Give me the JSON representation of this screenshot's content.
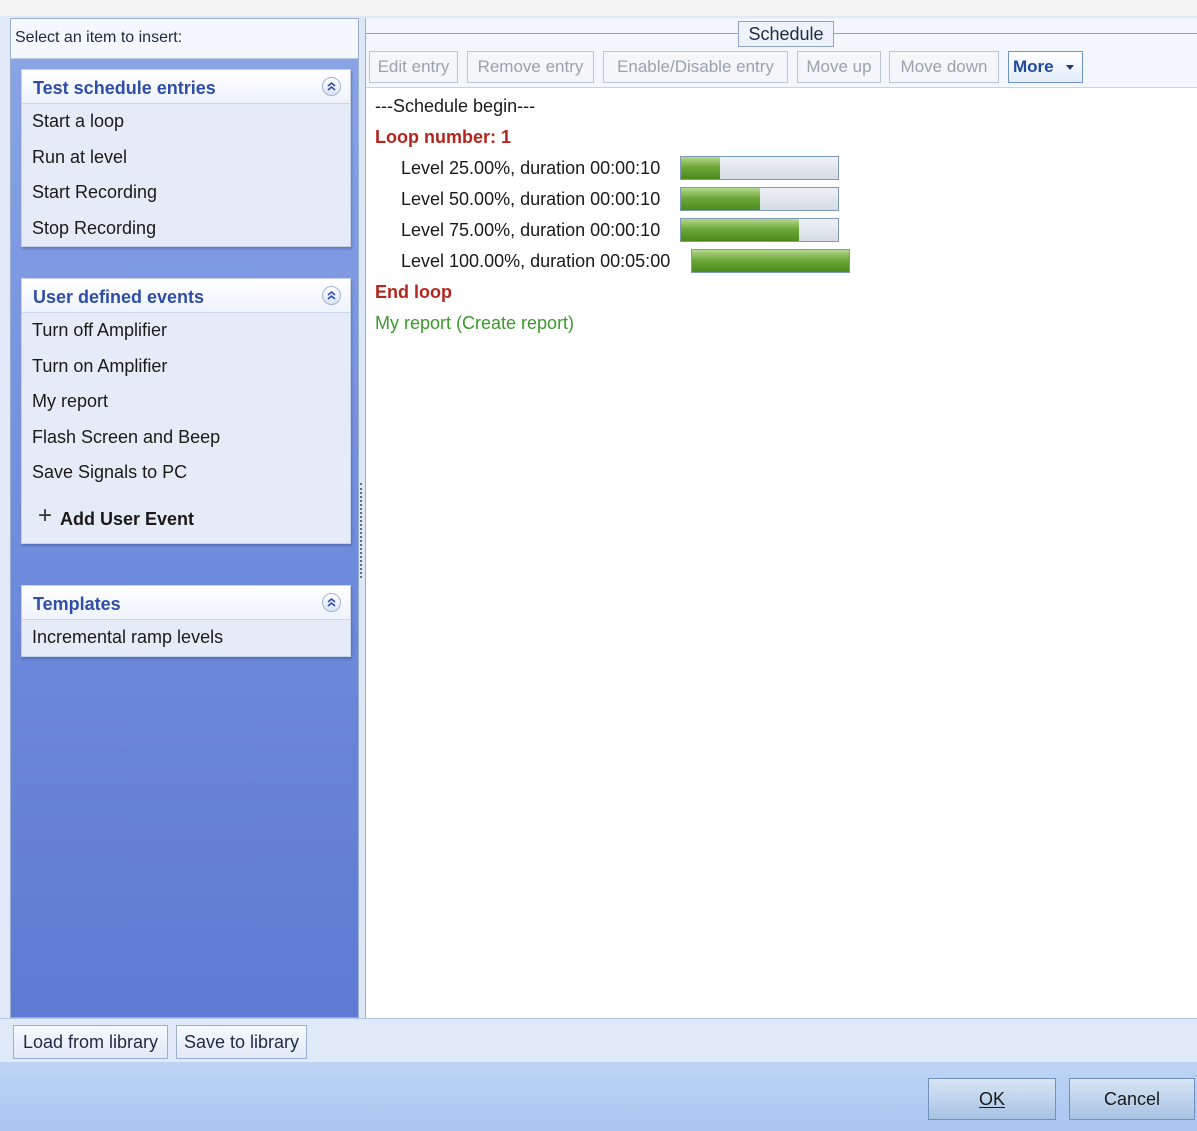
{
  "left": {
    "header": "Select an item to insert:",
    "groups": [
      {
        "title": "Test schedule entries",
        "items": [
          "Start a loop",
          "Run at level",
          "Start Recording",
          "Stop Recording"
        ]
      },
      {
        "title": "User defined events",
        "items": [
          "Turn off Amplifier",
          "Turn on Amplifier",
          "My report",
          "Flash Screen and Beep",
          "Save Signals to PC"
        ],
        "add_label": "Add User Event"
      },
      {
        "title": "Templates",
        "items": [
          "Incremental ramp levels"
        ]
      }
    ]
  },
  "schedule": {
    "tab": "Schedule",
    "toolbar": {
      "edit": "Edit entry",
      "remove": "Remove entry",
      "enable": "Enable/Disable entry",
      "move_up": "Move up",
      "move_down": "Move down",
      "more": "More"
    },
    "begin": "---Schedule begin---",
    "loop_start": "Loop number: 1",
    "levels": [
      {
        "text": "Level 25.00%, duration 00:00:10",
        "fill": 0.25
      },
      {
        "text": "Level 50.00%, duration 00:00:10",
        "fill": 0.5
      },
      {
        "text": "Level 75.00%, duration 00:00:10",
        "fill": 0.75
      },
      {
        "text": "Level 100.00%, duration 00:05:00",
        "fill": 1.0
      }
    ],
    "loop_end": "End loop",
    "report": "My report (Create report)"
  },
  "library": {
    "load": "Load from library",
    "save": "Save to library"
  },
  "dialog": {
    "ok": "OK",
    "cancel": "Cancel"
  },
  "colors": {
    "loop": "#b3261e",
    "report": "#3a9a2a",
    "group_title": "#2f4ea8",
    "progress": "#5f9a2c"
  }
}
